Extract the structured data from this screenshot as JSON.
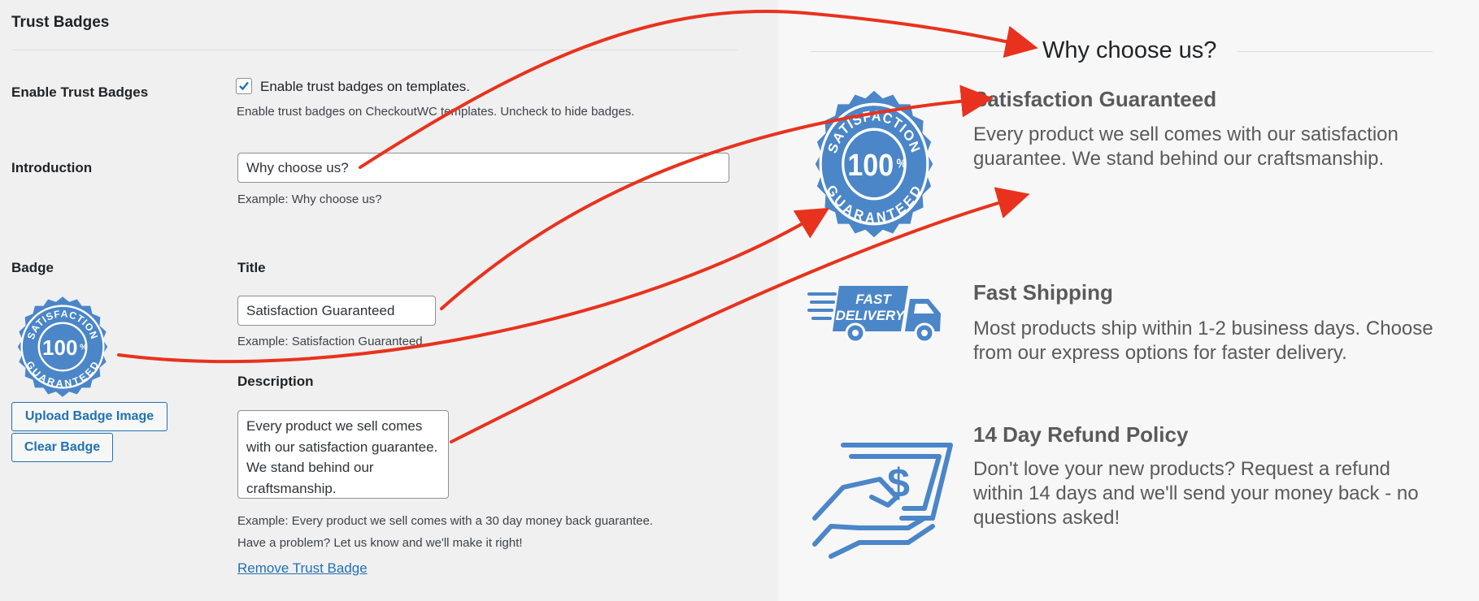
{
  "section_title": "Trust Badges",
  "enable": {
    "label": "Enable Trust Badges",
    "checkbox_label": "Enable trust badges on templates.",
    "help": "Enable trust badges on CheckoutWC templates. Uncheck to hide badges.",
    "checked": true
  },
  "introduction": {
    "label": "Introduction",
    "value": "Why choose us?",
    "example": "Example: Why choose us?"
  },
  "badge": {
    "label": "Badge",
    "upload_button": "Upload Badge Image",
    "clear_button": "Clear Badge",
    "seal_text_top": "SATISFACTION",
    "seal_text_center": "100",
    "seal_text_percent": "%",
    "seal_text_bottom": "GUARANTEED",
    "title_label": "Title",
    "title_value": "Satisfaction Guaranteed",
    "title_example": "Example: Satisfaction Guaranteed",
    "description_label": "Description",
    "description_value": "Every product we sell comes with our satisfaction guarantee. We stand behind our craftsmanship.",
    "description_example_1": "Example: Every product we sell comes with a 30 day money back guarantee.",
    "description_example_2": "Have a problem? Let us know and we'll make it right!",
    "remove_link": "Remove Trust Badge"
  },
  "preview": {
    "heading": "Why choose us?",
    "items": [
      {
        "icon": "satisfaction-seal-icon",
        "title": "Satisfaction Guaranteed",
        "text": "Every product we sell comes with our satisfaction guarantee. We stand behind our craftsmanship."
      },
      {
        "icon": "fast-delivery-truck-icon",
        "icon_text_1": "FAST",
        "icon_text_2": "DELIVERY",
        "title": "Fast Shipping",
        "text": "Most products ship within 1-2 business days. Choose from our express options for faster delivery."
      },
      {
        "icon": "refund-money-hand-icon",
        "title": "14 Day Refund Policy",
        "text": "Don't love your new products? Request a refund within 14 days and we'll send your money back - no questions asked!"
      }
    ]
  },
  "colors": {
    "badge_blue": "#4a86c8",
    "arrow_red": "#e8321d",
    "link_blue": "#2271b1"
  }
}
